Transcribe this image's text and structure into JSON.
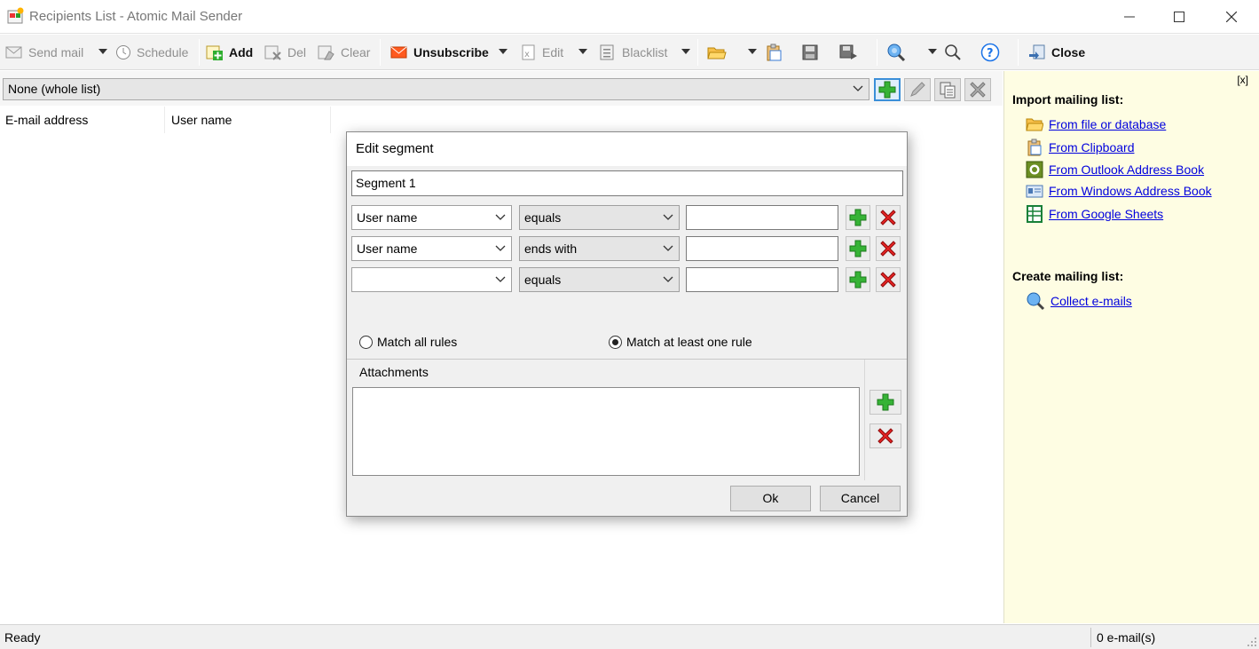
{
  "window": {
    "title": "Recipients List - Atomic Mail Sender"
  },
  "toolbar": {
    "send_mail": "Send mail",
    "schedule": "Schedule",
    "add": "Add",
    "del": "Del",
    "clear": "Clear",
    "unsubscribe": "Unsubscribe",
    "edit": "Edit",
    "blacklist": "Blacklist",
    "close": "Close"
  },
  "segment_bar": {
    "selected": "None (whole list)"
  },
  "list": {
    "columns": [
      "E-mail address",
      "User name"
    ]
  },
  "side_panel": {
    "close_label": "[x]",
    "import_heading": "Import mailing list:",
    "import_links": [
      "From file or database",
      "From Clipboard",
      "From Outlook Address Book",
      "From Windows Address Book",
      "From Google Sheets"
    ],
    "create_heading": "Create mailing list:",
    "create_links": [
      "Collect e-mails"
    ]
  },
  "dialog": {
    "title": "Edit segment",
    "segment_name": "Segment 1",
    "rules": [
      {
        "field": "User name",
        "operator": "equals",
        "value": ""
      },
      {
        "field": "User name",
        "operator": "ends with",
        "value": ""
      },
      {
        "field": "",
        "operator": "equals",
        "value": ""
      }
    ],
    "match_all_label": "Match all rules",
    "match_any_label": "Match at least one rule",
    "match_selected": "any",
    "attachments_label": "Attachments",
    "ok_label": "Ok",
    "cancel_label": "Cancel"
  },
  "status": {
    "left": "Ready",
    "right": "0 e-mail(s)"
  },
  "colors": {
    "link": "#0000dd",
    "panel_bg": "#fefde3",
    "add_green": "#2fae2f",
    "delete_red": "#e02020"
  }
}
